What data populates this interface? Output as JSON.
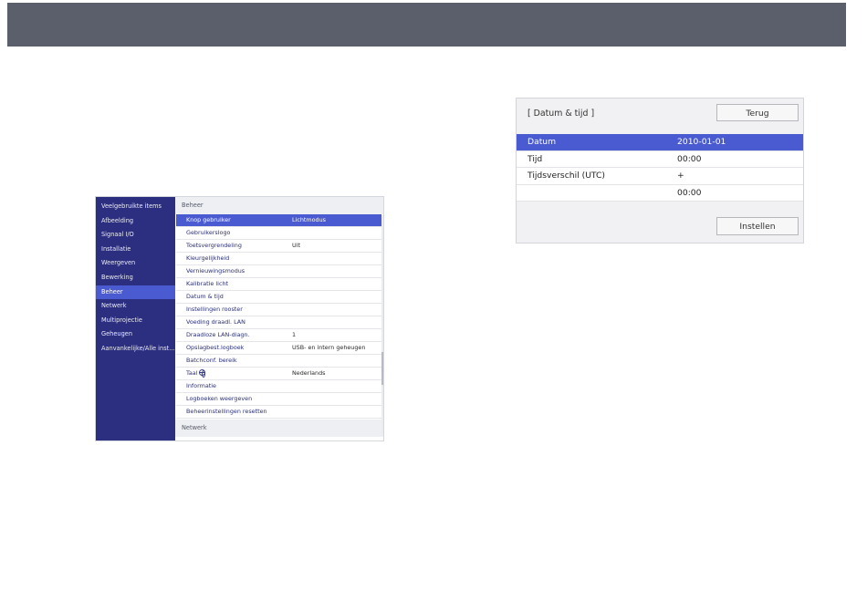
{
  "menu": {
    "sidebar": [
      {
        "label": "Veelgebruikte items"
      },
      {
        "label": "Afbeelding"
      },
      {
        "label": "Signaal I/O"
      },
      {
        "label": "Installatie"
      },
      {
        "label": "Weergeven"
      },
      {
        "label": "Bewerking"
      },
      {
        "label": "Beheer",
        "active": true
      },
      {
        "label": "Netwerk"
      },
      {
        "label": "Multiprojectie"
      },
      {
        "label": "Geheugen"
      },
      {
        "label": "Aanvankelijke/Alle inst..."
      }
    ],
    "section_header": "Beheer",
    "rows": [
      {
        "label": "Knop gebruiker",
        "value": "Lichtmodus",
        "active": true
      },
      {
        "label": "Gebruikerslogo",
        "value": ""
      },
      {
        "label": "Toetsvergrendeling",
        "value": "Uit"
      },
      {
        "label": "Kleurgelijkheid",
        "value": ""
      },
      {
        "label": "Vernieuwingsmodus",
        "value": ""
      },
      {
        "label": "Kalibratie licht",
        "value": ""
      },
      {
        "label": "Datum & tijd",
        "value": ""
      },
      {
        "label": "Instellingen rooster",
        "value": ""
      },
      {
        "label": "Voeding draadl. LAN",
        "value": ""
      },
      {
        "label": "Draadloze LAN-diagn.",
        "value": "1"
      },
      {
        "label": "Opslagbest.logboek",
        "value": "USB- en intern geheugen"
      },
      {
        "label": "Batchconf. bereik",
        "value": ""
      },
      {
        "label": "Taal",
        "value": "Nederlands",
        "icon": "globe-icon"
      },
      {
        "label": "Informatie",
        "value": ""
      },
      {
        "label": "Logboeken weergeven",
        "value": ""
      },
      {
        "label": "Beheerinstellingen resetten",
        "value": ""
      }
    ],
    "next_section_header": "Netwerk"
  },
  "dialog": {
    "title": "[ Datum & tijd ]",
    "back_label": "Terug",
    "set_label": "Instellen",
    "rows": [
      {
        "label": "Datum",
        "value": "2010-01-01",
        "active": true
      },
      {
        "label": "Tijd",
        "value": "00:00"
      },
      {
        "label": "Tijdsverschil (UTC)",
        "value": "+"
      },
      {
        "label": "",
        "value": "00:00"
      }
    ]
  },
  "colors": {
    "banner": "#5b5f6b",
    "sidebar": "#2c2f80",
    "highlight": "#4a5ad0"
  }
}
